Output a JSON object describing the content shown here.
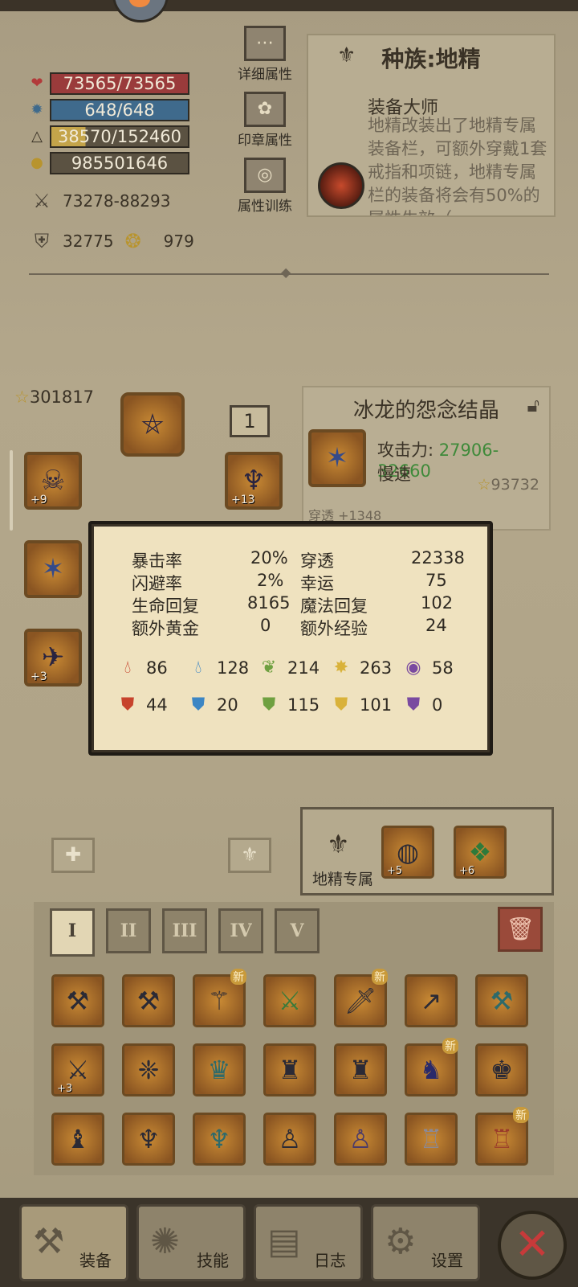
{
  "stats": {
    "hp": "73565/73565",
    "mp": "648/648",
    "xp": "38570/152460",
    "gold": "985501646",
    "attack": "73278-88293",
    "defense": "32775",
    "gems": "979"
  },
  "menu": {
    "detail": "详细属性",
    "seal": "印章属性",
    "training": "属性训练"
  },
  "race": {
    "title": "种族:地精",
    "skill_name": "装备大师",
    "skill_desc": "地精改装出了地精专属装备栏，可额外穿戴1套戒指和项链，地精专属栏的装备将会有50%的属性生效（"
  },
  "equip": {
    "power": "301817",
    "level_box": "1",
    "slot_levels": [
      "+9",
      "+13",
      "+3"
    ]
  },
  "item": {
    "title": "冰龙的怨念结晶",
    "attack_label": "攻击力:",
    "attack_value": "27906-32660",
    "speed": "慢速",
    "power": "93732",
    "sub": "穿透 +1348"
  },
  "tooltip": {
    "rows": [
      {
        "l1": "暴击率",
        "v1": "20%",
        "l2": "穿透",
        "v2": "22338"
      },
      {
        "l1": "闪避率",
        "v1": "2%",
        "l2": "幸运",
        "v2": "75"
      },
      {
        "l1": "生命回复",
        "v1": "8165",
        "l2": "魔法回复",
        "v2": "102"
      },
      {
        "l1": "额外黄金",
        "v1": "0",
        "l2": "额外经验",
        "v2": "24"
      }
    ],
    "element_attack": [
      "86",
      "128",
      "214",
      "263",
      "58"
    ],
    "element_resist": [
      "44",
      "20",
      "115",
      "101",
      "0"
    ],
    "element_colors": [
      "#c7432c",
      "#3c86c4",
      "#6fa040",
      "#d9b23a",
      "#7a4aa0"
    ]
  },
  "gnome": {
    "label": "地精专属",
    "slot_levels": [
      "+5",
      "+6"
    ]
  },
  "inventory": {
    "tabs": [
      "I",
      "II",
      "III",
      "IV",
      "V"
    ],
    "new_label": "新",
    "level_label": "+3"
  },
  "nav": {
    "equip": "装备",
    "skill": "技能",
    "log": "日志",
    "settings": "设置"
  }
}
